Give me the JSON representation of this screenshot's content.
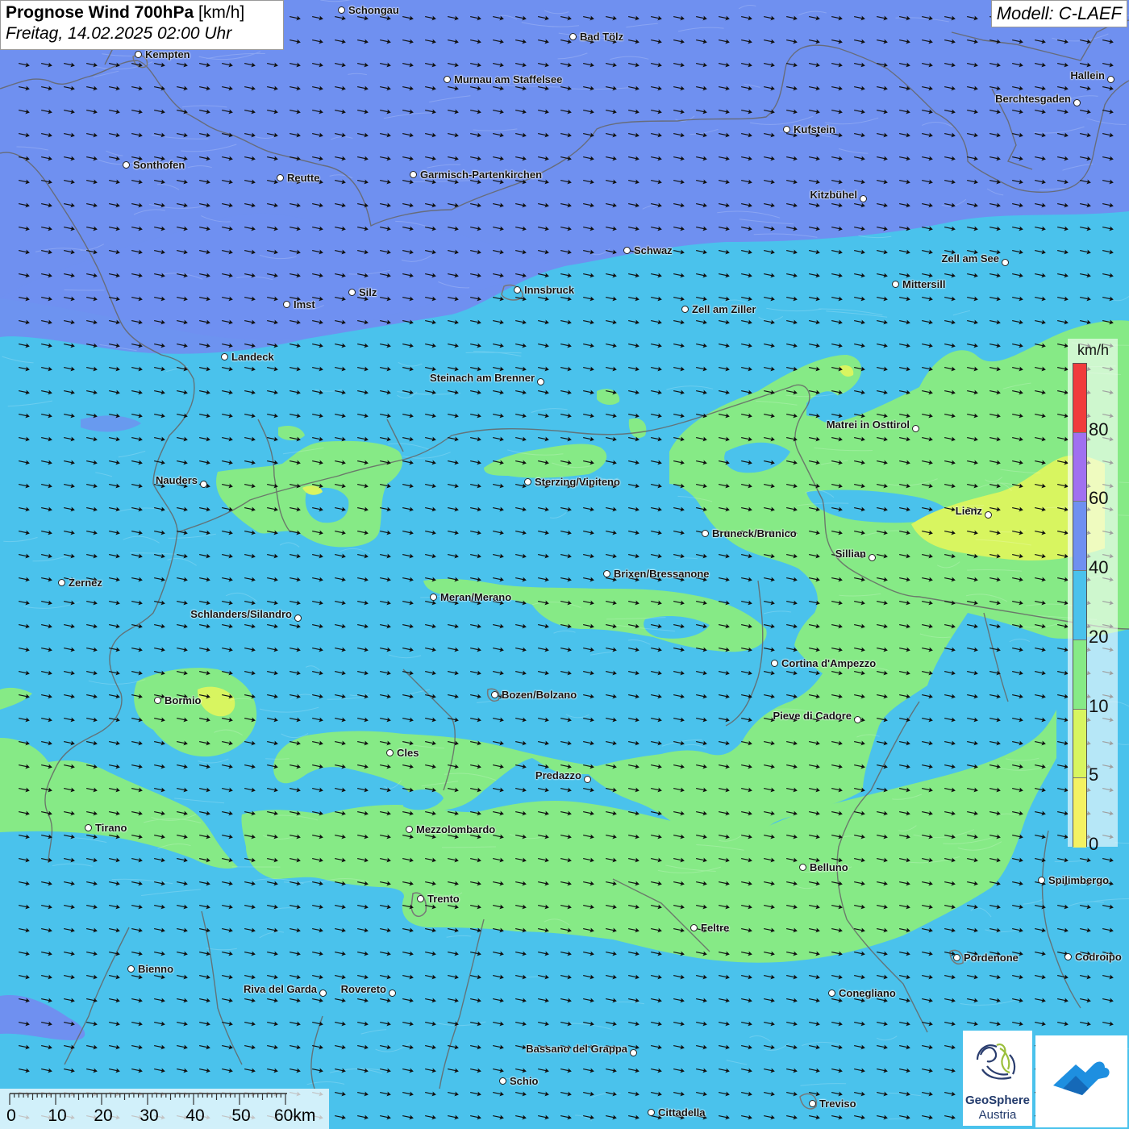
{
  "title": {
    "main": "Prognose Wind 700hPa",
    "unit": "[km/h]",
    "date": "Freitag, 14.02.2025 02:00 Uhr"
  },
  "model": "Modell: C-LAEF",
  "legend": {
    "unit": "km/h",
    "labels": [
      "80",
      "60",
      "40",
      "20",
      "10",
      "5",
      "0"
    ],
    "colors": [
      "#f03c3c",
      "#a070f0",
      "#6f90f0",
      "#4ac2ec",
      "#86ea86",
      "#d8f560",
      "#f4f262"
    ]
  },
  "scalebar": {
    "ticks": [
      "0",
      "10",
      "20",
      "30",
      "40",
      "50",
      "60km"
    ]
  },
  "logo": {
    "line1": "GeoSphere",
    "line2": "Austria"
  },
  "icons": {
    "wind_arrow": "wind-arrow-icon",
    "city": "city-dot-icon",
    "logo": "geosphere-logo-icon",
    "app": "app-logo-icon"
  },
  "wind": {
    "direction": "west-southwest",
    "arrow_angle_deg": 12
  },
  "cities": [
    {
      "name": "Schongau"
    },
    {
      "name": "Bad Tölz"
    },
    {
      "name": "Kempten"
    },
    {
      "name": "Murnau am Staffelsee"
    },
    {
      "name": "Hallein"
    },
    {
      "name": "Berchtesgaden"
    },
    {
      "name": "Kufstein"
    },
    {
      "name": "Sonthofen"
    },
    {
      "name": "Reutte"
    },
    {
      "name": "Garmisch-Partenkirchen"
    },
    {
      "name": "Kitzbühel"
    },
    {
      "name": "Schwaz"
    },
    {
      "name": "Zell am See"
    },
    {
      "name": "Mittersill"
    },
    {
      "name": "Innsbruck"
    },
    {
      "name": "Silz"
    },
    {
      "name": "Imst"
    },
    {
      "name": "Zell am Ziller"
    },
    {
      "name": "Landeck"
    },
    {
      "name": "Steinach am Brenner"
    },
    {
      "name": "Matrei in Osttirol"
    },
    {
      "name": "Nauders"
    },
    {
      "name": "Sterzing/Vipiteno"
    },
    {
      "name": "Lienz"
    },
    {
      "name": "Bruneck/Brunico"
    },
    {
      "name": "Sillian"
    },
    {
      "name": "Zernez"
    },
    {
      "name": "Brixen/Bressanone"
    },
    {
      "name": "Meran/Merano"
    },
    {
      "name": "Schlanders/Silandro"
    },
    {
      "name": "Cortina d'Ampezzo"
    },
    {
      "name": "Bormio"
    },
    {
      "name": "Bozen/Bolzano"
    },
    {
      "name": "Pieve di Cadore"
    },
    {
      "name": "Cles"
    },
    {
      "name": "Predazzo"
    },
    {
      "name": "Tirano"
    },
    {
      "name": "Mezzolombardo"
    },
    {
      "name": "Belluno"
    },
    {
      "name": "Spilimbergo"
    },
    {
      "name": "Trento"
    },
    {
      "name": "Feltre"
    },
    {
      "name": "Pordenone"
    },
    {
      "name": "Codroipo"
    },
    {
      "name": "Bienno"
    },
    {
      "name": "Riva del Garda"
    },
    {
      "name": "Rovereto"
    },
    {
      "name": "Conegliano"
    },
    {
      "name": "Bassano del Grappa"
    },
    {
      "name": "Schio"
    },
    {
      "name": "Treviso"
    },
    {
      "name": "Cittadella"
    }
  ]
}
